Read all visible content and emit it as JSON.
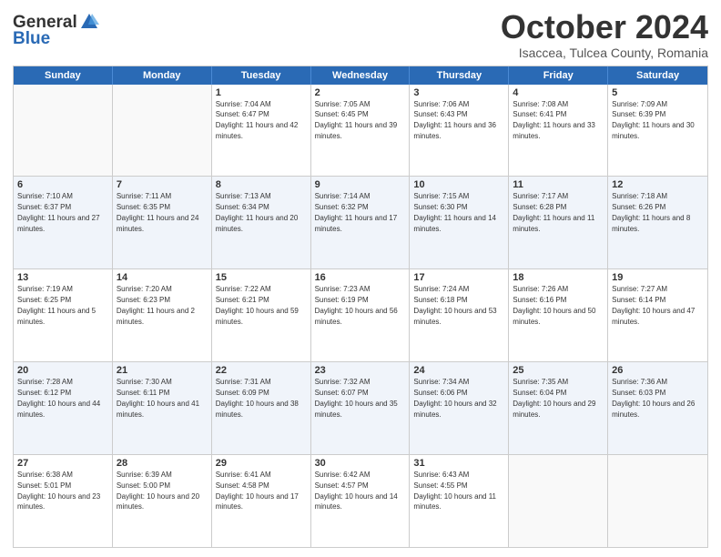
{
  "header": {
    "logo_general": "General",
    "logo_blue": "Blue",
    "month": "October 2024",
    "location": "Isaccea, Tulcea County, Romania"
  },
  "days_of_week": [
    "Sunday",
    "Monday",
    "Tuesday",
    "Wednesday",
    "Thursday",
    "Friday",
    "Saturday"
  ],
  "weeks": [
    [
      {
        "day": "",
        "info": ""
      },
      {
        "day": "",
        "info": ""
      },
      {
        "day": "1",
        "info": "Sunrise: 7:04 AM\nSunset: 6:47 PM\nDaylight: 11 hours and 42 minutes."
      },
      {
        "day": "2",
        "info": "Sunrise: 7:05 AM\nSunset: 6:45 PM\nDaylight: 11 hours and 39 minutes."
      },
      {
        "day": "3",
        "info": "Sunrise: 7:06 AM\nSunset: 6:43 PM\nDaylight: 11 hours and 36 minutes."
      },
      {
        "day": "4",
        "info": "Sunrise: 7:08 AM\nSunset: 6:41 PM\nDaylight: 11 hours and 33 minutes."
      },
      {
        "day": "5",
        "info": "Sunrise: 7:09 AM\nSunset: 6:39 PM\nDaylight: 11 hours and 30 minutes."
      }
    ],
    [
      {
        "day": "6",
        "info": "Sunrise: 7:10 AM\nSunset: 6:37 PM\nDaylight: 11 hours and 27 minutes."
      },
      {
        "day": "7",
        "info": "Sunrise: 7:11 AM\nSunset: 6:35 PM\nDaylight: 11 hours and 24 minutes."
      },
      {
        "day": "8",
        "info": "Sunrise: 7:13 AM\nSunset: 6:34 PM\nDaylight: 11 hours and 20 minutes."
      },
      {
        "day": "9",
        "info": "Sunrise: 7:14 AM\nSunset: 6:32 PM\nDaylight: 11 hours and 17 minutes."
      },
      {
        "day": "10",
        "info": "Sunrise: 7:15 AM\nSunset: 6:30 PM\nDaylight: 11 hours and 14 minutes."
      },
      {
        "day": "11",
        "info": "Sunrise: 7:17 AM\nSunset: 6:28 PM\nDaylight: 11 hours and 11 minutes."
      },
      {
        "day": "12",
        "info": "Sunrise: 7:18 AM\nSunset: 6:26 PM\nDaylight: 11 hours and 8 minutes."
      }
    ],
    [
      {
        "day": "13",
        "info": "Sunrise: 7:19 AM\nSunset: 6:25 PM\nDaylight: 11 hours and 5 minutes."
      },
      {
        "day": "14",
        "info": "Sunrise: 7:20 AM\nSunset: 6:23 PM\nDaylight: 11 hours and 2 minutes."
      },
      {
        "day": "15",
        "info": "Sunrise: 7:22 AM\nSunset: 6:21 PM\nDaylight: 10 hours and 59 minutes."
      },
      {
        "day": "16",
        "info": "Sunrise: 7:23 AM\nSunset: 6:19 PM\nDaylight: 10 hours and 56 minutes."
      },
      {
        "day": "17",
        "info": "Sunrise: 7:24 AM\nSunset: 6:18 PM\nDaylight: 10 hours and 53 minutes."
      },
      {
        "day": "18",
        "info": "Sunrise: 7:26 AM\nSunset: 6:16 PM\nDaylight: 10 hours and 50 minutes."
      },
      {
        "day": "19",
        "info": "Sunrise: 7:27 AM\nSunset: 6:14 PM\nDaylight: 10 hours and 47 minutes."
      }
    ],
    [
      {
        "day": "20",
        "info": "Sunrise: 7:28 AM\nSunset: 6:12 PM\nDaylight: 10 hours and 44 minutes."
      },
      {
        "day": "21",
        "info": "Sunrise: 7:30 AM\nSunset: 6:11 PM\nDaylight: 10 hours and 41 minutes."
      },
      {
        "day": "22",
        "info": "Sunrise: 7:31 AM\nSunset: 6:09 PM\nDaylight: 10 hours and 38 minutes."
      },
      {
        "day": "23",
        "info": "Sunrise: 7:32 AM\nSunset: 6:07 PM\nDaylight: 10 hours and 35 minutes."
      },
      {
        "day": "24",
        "info": "Sunrise: 7:34 AM\nSunset: 6:06 PM\nDaylight: 10 hours and 32 minutes."
      },
      {
        "day": "25",
        "info": "Sunrise: 7:35 AM\nSunset: 6:04 PM\nDaylight: 10 hours and 29 minutes."
      },
      {
        "day": "26",
        "info": "Sunrise: 7:36 AM\nSunset: 6:03 PM\nDaylight: 10 hours and 26 minutes."
      }
    ],
    [
      {
        "day": "27",
        "info": "Sunrise: 6:38 AM\nSunset: 5:01 PM\nDaylight: 10 hours and 23 minutes."
      },
      {
        "day": "28",
        "info": "Sunrise: 6:39 AM\nSunset: 5:00 PM\nDaylight: 10 hours and 20 minutes."
      },
      {
        "day": "29",
        "info": "Sunrise: 6:41 AM\nSunset: 4:58 PM\nDaylight: 10 hours and 17 minutes."
      },
      {
        "day": "30",
        "info": "Sunrise: 6:42 AM\nSunset: 4:57 PM\nDaylight: 10 hours and 14 minutes."
      },
      {
        "day": "31",
        "info": "Sunrise: 6:43 AM\nSunset: 4:55 PM\nDaylight: 10 hours and 11 minutes."
      },
      {
        "day": "",
        "info": ""
      },
      {
        "day": "",
        "info": ""
      }
    ]
  ]
}
